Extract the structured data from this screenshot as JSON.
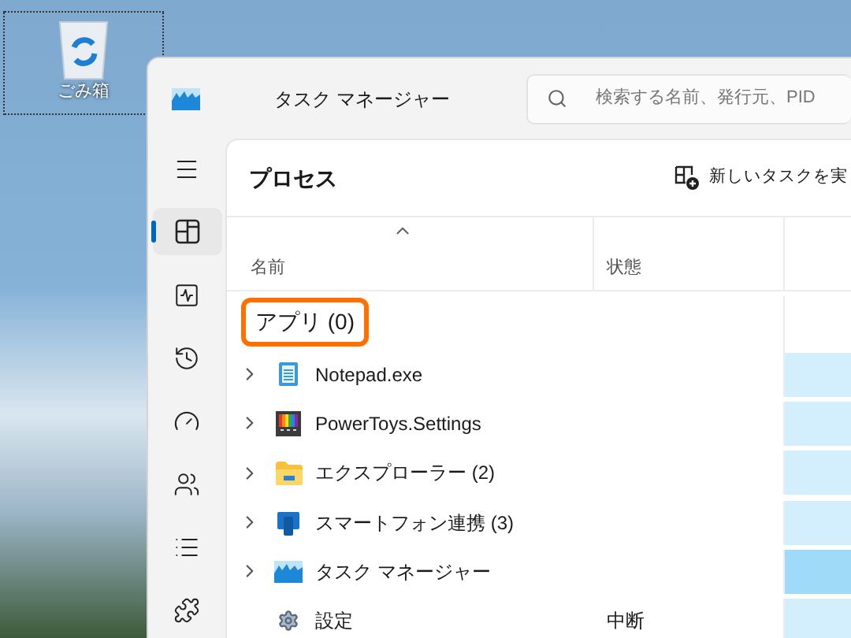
{
  "desktop": {
    "icons": [
      {
        "label": "ごみ箱",
        "selected": true
      }
    ]
  },
  "window": {
    "title": "タスク マネージャー",
    "search": {
      "placeholder": "検索する名前、発行元、PID"
    }
  },
  "sidebar": {
    "items": [
      {
        "kind": "menu",
        "selected": false
      },
      {
        "kind": "processes",
        "selected": true
      },
      {
        "kind": "performance",
        "selected": false
      },
      {
        "kind": "history",
        "selected": false
      },
      {
        "kind": "startup",
        "selected": false
      },
      {
        "kind": "users",
        "selected": false
      },
      {
        "kind": "details",
        "selected": false
      },
      {
        "kind": "services",
        "selected": false
      }
    ]
  },
  "page": {
    "title": "プロセス",
    "toolbar": {
      "new_task": "新しいタスクを実"
    }
  },
  "table": {
    "columns": [
      "名前",
      "状態"
    ],
    "group": {
      "label": "アプリ (0)",
      "highlighted": true
    },
    "rows": [
      {
        "kind": "notepad",
        "name": "Notepad.exe",
        "expandable": true,
        "status": "",
        "color": "#d3eefc"
      },
      {
        "kind": "powertoys",
        "name": "PowerToys.Settings",
        "expandable": true,
        "status": "",
        "color": "#d3eefc"
      },
      {
        "kind": "folder",
        "name": "エクスプローラー (2)",
        "expandable": true,
        "status": "",
        "color": "#d3eefc"
      },
      {
        "kind": "phone",
        "name": "スマートフォン連携 (3)",
        "expandable": true,
        "status": "",
        "color": "#d3eefc"
      },
      {
        "kind": "taskmgr",
        "name": "タスク マネージャー",
        "expandable": true,
        "status": "",
        "color": "#9fdaf8"
      },
      {
        "kind": "settings",
        "name": "設定",
        "expandable": false,
        "status": "中断",
        "color": "#d3eefc"
      }
    ]
  }
}
